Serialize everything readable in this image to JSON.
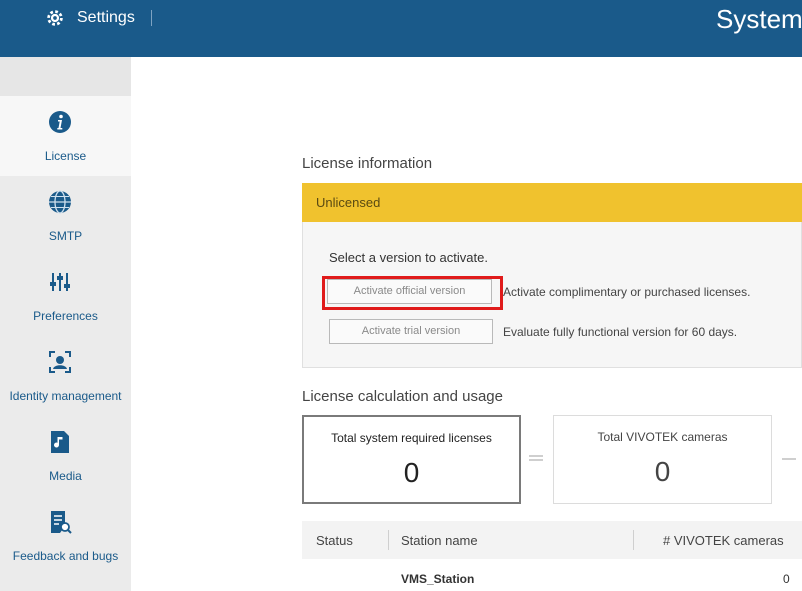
{
  "header": {
    "settings_label": "Settings",
    "title": "System"
  },
  "sidebar": {
    "items": [
      {
        "label": "License",
        "icon": "info-icon",
        "active": true
      },
      {
        "label": "SMTP",
        "icon": "globe-icon",
        "active": false
      },
      {
        "label": "Preferences",
        "icon": "sliders-icon",
        "active": false
      },
      {
        "label": "Identity management",
        "icon": "identity-icon",
        "active": false
      },
      {
        "label": "Media",
        "icon": "music-file-icon",
        "active": false
      },
      {
        "label": "Feedback and bugs",
        "icon": "feedback-document-icon",
        "active": false
      }
    ]
  },
  "license": {
    "section_title": "License information",
    "status": "Unlicensed",
    "select_prompt": "Select a version to activate.",
    "official_button": "Activate official version",
    "official_desc": "Activate complimentary or purchased licenses.",
    "trial_button": "Activate trial version",
    "trial_desc": "Evaluate fully functional version for 60 days."
  },
  "usage": {
    "section_title": "License calculation and usage",
    "cards": [
      {
        "label": "Total system required licenses",
        "value": "0"
      },
      {
        "label": "Total VIVOTEK cameras",
        "value": "0"
      }
    ]
  },
  "table": {
    "headers": [
      "Status",
      "Station name",
      "# VIVOTEK cameras"
    ],
    "rows": [
      {
        "status": "",
        "station": "VMS_Station",
        "cameras": "0"
      }
    ]
  },
  "colors": {
    "header_bg": "#1a5a8a",
    "accent": "#1a5a8a",
    "status_bar": "#f0c22e",
    "highlight": "#e01b1b"
  }
}
